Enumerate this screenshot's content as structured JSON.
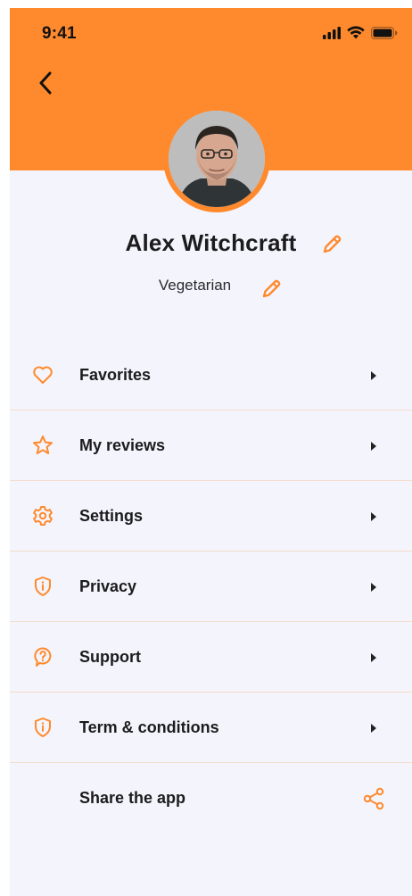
{
  "status_bar": {
    "time": "9:41"
  },
  "colors": {
    "accent": "#ff8a2d",
    "background": "#f4f4fc",
    "text": "#1c1c1e",
    "divider": "#f3dccb"
  },
  "profile": {
    "name": "Alex Witchcraft",
    "diet": "Vegetarian"
  },
  "menu": {
    "items": [
      {
        "label": "Favorites",
        "icon": "heart-icon"
      },
      {
        "label": "My reviews",
        "icon": "star-icon"
      },
      {
        "label": "Settings",
        "icon": "gear-icon"
      },
      {
        "label": "Privacy",
        "icon": "shield-info-icon"
      },
      {
        "label": "Support",
        "icon": "question-bubble-icon"
      },
      {
        "label": "Term & conditions",
        "icon": "shield-info-icon"
      },
      {
        "label": "Share the app",
        "icon": "share-icon"
      }
    ]
  }
}
